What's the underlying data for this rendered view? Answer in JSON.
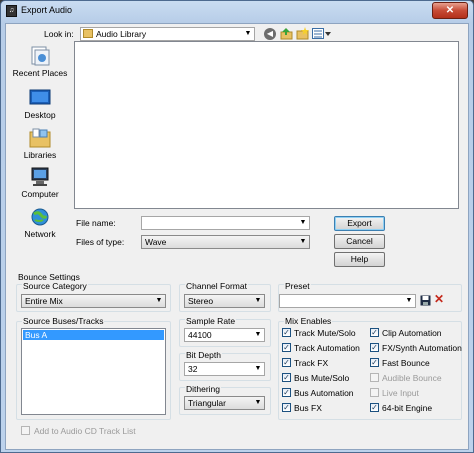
{
  "window": {
    "title": "Export Audio",
    "close_glyph": "✕"
  },
  "look_in": {
    "label": "Look in:",
    "value": "Audio Library"
  },
  "places": [
    {
      "label": "Recent Places",
      "icon": "recent-places-icon"
    },
    {
      "label": "Desktop",
      "icon": "desktop-icon"
    },
    {
      "label": "Libraries",
      "icon": "libraries-icon"
    },
    {
      "label": "Computer",
      "icon": "computer-icon"
    },
    {
      "label": "Network",
      "icon": "network-icon"
    }
  ],
  "file_name": {
    "label": "File name:",
    "value": ""
  },
  "file_type": {
    "label": "Files of type:",
    "value": "Wave"
  },
  "buttons": {
    "export": "Export",
    "cancel": "Cancel",
    "help": "Help"
  },
  "bounce": {
    "heading": "Bounce Settings",
    "source_category": {
      "label": "Source Category",
      "value": "Entire Mix"
    },
    "source_buses": {
      "label": "Source Buses/Tracks",
      "items": [
        "Bus A"
      ]
    },
    "channel_format": {
      "label": "Channel Format",
      "value": "Stereo"
    },
    "sample_rate": {
      "label": "Sample Rate",
      "value": "44100"
    },
    "bit_depth": {
      "label": "Bit Depth",
      "value": "32"
    },
    "dithering": {
      "label": "Dithering",
      "value": "Triangular"
    },
    "preset": {
      "label": "Preset",
      "value": ""
    },
    "mix_enables": {
      "label": "Mix Enables",
      "left": [
        {
          "label": "Track Mute/Solo",
          "checked": true,
          "enabled": true
        },
        {
          "label": "Track Automation",
          "checked": true,
          "enabled": true
        },
        {
          "label": "Track FX",
          "checked": true,
          "enabled": true
        },
        {
          "label": "Bus Mute/Solo",
          "checked": true,
          "enabled": true
        },
        {
          "label": "Bus Automation",
          "checked": true,
          "enabled": true
        },
        {
          "label": "Bus FX",
          "checked": true,
          "enabled": true
        }
      ],
      "right": [
        {
          "label": "Clip Automation",
          "checked": true,
          "enabled": true
        },
        {
          "label": "FX/Synth Automation",
          "checked": true,
          "enabled": true
        },
        {
          "label": "Fast Bounce",
          "checked": true,
          "enabled": true
        },
        {
          "label": "Audible Bounce",
          "checked": false,
          "enabled": false
        },
        {
          "label": "Live Input",
          "checked": false,
          "enabled": false
        },
        {
          "label": "64-bit Engine",
          "checked": true,
          "enabled": true
        }
      ]
    },
    "add_to_cd": {
      "label": "Add to Audio CD Track List",
      "checked": false,
      "enabled": false
    }
  },
  "colors": {
    "selection": "#3399ff",
    "title_bar": "#bcd2ec",
    "close_button": "#c74b36"
  }
}
